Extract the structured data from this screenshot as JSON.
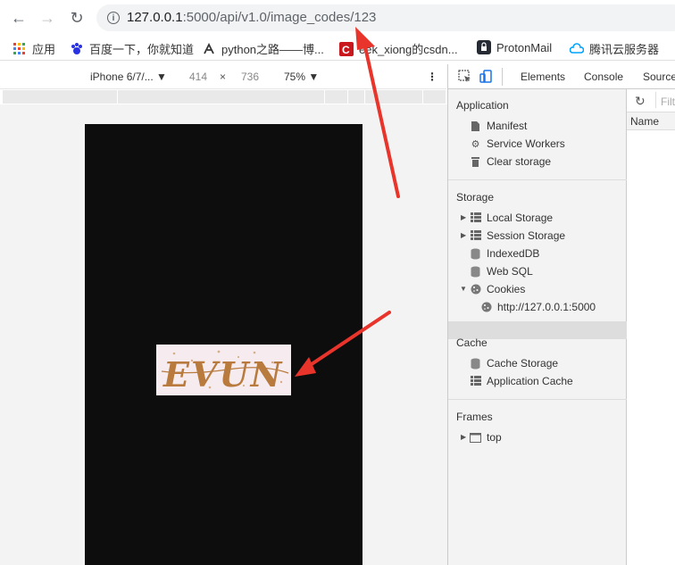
{
  "browser": {
    "url_host": "127.0.0.1",
    "url_path": ":5000/api/v1.0/image_codes/123",
    "bookmarks": [
      "应用",
      "百度一下，你就知道",
      "python之路——博...",
      "eek_xiong的csdn...",
      "ProtonMail",
      "腾讯云服务器"
    ]
  },
  "device_toolbar": {
    "device": "iPhone 6/7/...",
    "width": "414",
    "times": "×",
    "height": "736",
    "zoom": "75%"
  },
  "devtools": {
    "tabs": [
      "Elements",
      "Console",
      "Source"
    ],
    "application_title": "Application",
    "application_items": [
      "Manifest",
      "Service Workers",
      "Clear storage"
    ],
    "storage_title": "Storage",
    "storage_items": [
      "Local Storage",
      "Session Storage",
      "IndexedDB",
      "Web SQL",
      "Cookies"
    ],
    "cookie_origin": "http://127.0.0.1:5000",
    "cache_title": "Cache",
    "cache_items": [
      "Cache Storage",
      "Application Cache"
    ],
    "frames_title": "Frames",
    "frames_item": "top",
    "filter_placeholder": "Filte",
    "name_header": "Name"
  },
  "captcha": {
    "text": "EVUN"
  },
  "colors": {
    "captcha_text": "#b97a3e",
    "annotation_arrow": "#e8342a"
  }
}
